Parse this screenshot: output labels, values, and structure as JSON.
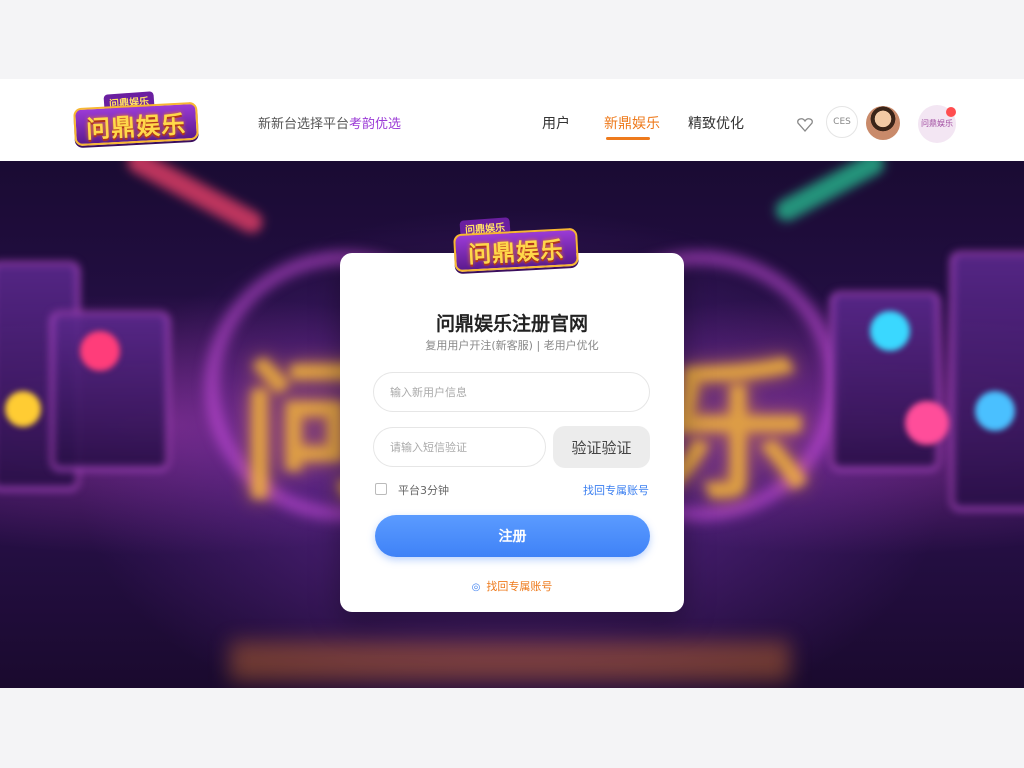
{
  "header": {
    "logo_badge": "问鼎娱乐",
    "logo_text": "问鼎娱乐",
    "tagline_prefix": "新新台选择平台",
    "tagline_highlight": "考韵优选",
    "nav": [
      {
        "label": "用户",
        "active": false
      },
      {
        "label": "新鼎娱乐",
        "active": true
      },
      {
        "label": "精致优化",
        "active": false
      }
    ],
    "heart_icon": "heart-icon",
    "round_button_label": "CES",
    "profile_label": "问鼎娱乐"
  },
  "hero": {
    "background_text": "问鼎娱乐"
  },
  "card": {
    "logo_badge": "问鼎娱乐",
    "logo_text": "问鼎娱乐",
    "title": "问鼎娱乐注册官网",
    "subtitle": "复用用户开注(新客服) | 老用户优化",
    "phone_placeholder": "输入新用户信息",
    "code_placeholder": "请输入短信验证",
    "code_button": "验证验证",
    "remember_label": "平台3分钟",
    "link_right": "找回专属账号",
    "submit_label": "注册",
    "bottom_link": "找回专属账号"
  },
  "colors": {
    "accent_orange": "#ee7a1c",
    "primary_blue": "#3f82f7",
    "brand_purple": "#9b3bd6"
  }
}
